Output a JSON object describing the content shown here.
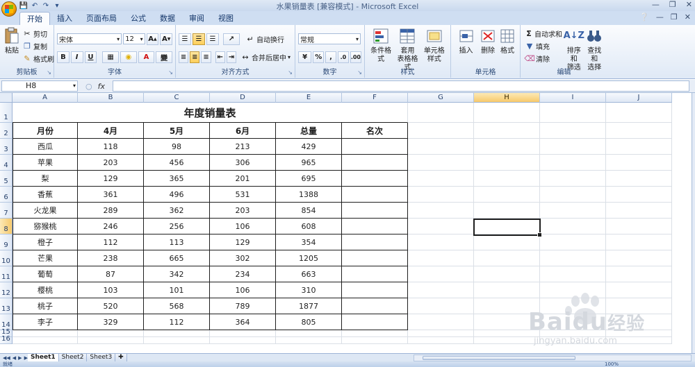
{
  "window": {
    "title": "水果销量表  [兼容模式] - Microsoft Excel"
  },
  "tabs": [
    {
      "label": "开始",
      "active": true
    },
    {
      "label": "插入"
    },
    {
      "label": "页面布局"
    },
    {
      "label": "公式"
    },
    {
      "label": "数据"
    },
    {
      "label": "审阅"
    },
    {
      "label": "视图"
    }
  ],
  "ribbon": {
    "clipboard": {
      "label": "剪贴板",
      "paste": "粘贴",
      "cut": "剪切",
      "copy": "复制",
      "format_painter": "格式刷"
    },
    "font": {
      "label": "字体",
      "font_name": "宋体",
      "font_size": "12",
      "bold": "B",
      "italic": "I",
      "underline": "U",
      "wen": "變"
    },
    "alignment": {
      "label": "对齐方式",
      "wrap": "自动换行",
      "merge": "合并后居中"
    },
    "number": {
      "label": "数字",
      "format": "常规",
      "percent": "%",
      "comma": ","
    },
    "styles": {
      "label": "样式",
      "conditional": "条件格式",
      "table_format": "套用\n表格格式",
      "cell_style": "单元格\n样式"
    },
    "cells": {
      "label": "单元格",
      "insert": "插入",
      "delete": "删除",
      "format": "格式"
    },
    "editing": {
      "label": "编辑",
      "autosum": "自动求和",
      "fill": "填充",
      "clear": "清除",
      "sort": "排序和\n筛选",
      "find": "查找和\n选择"
    }
  },
  "formula_bar": {
    "name_box": "H8",
    "fx": "fx",
    "value": ""
  },
  "columns": [
    "A",
    "B",
    "C",
    "D",
    "E",
    "F",
    "G",
    "H",
    "I",
    "J"
  ],
  "selected_cell": {
    "col": "H",
    "row": "8"
  },
  "sheet": {
    "title": "年度销量表",
    "headers": [
      "月份",
      "4月",
      "5月",
      "6月",
      "总量",
      "名次"
    ],
    "rows": [
      [
        "西瓜",
        "118",
        "98",
        "213",
        "429",
        ""
      ],
      [
        "苹果",
        "203",
        "456",
        "306",
        "965",
        ""
      ],
      [
        "梨",
        "129",
        "365",
        "201",
        "695",
        ""
      ],
      [
        "香蕉",
        "361",
        "496",
        "531",
        "1388",
        ""
      ],
      [
        "火龙果",
        "289",
        "362",
        "203",
        "854",
        ""
      ],
      [
        "猕猴桃",
        "246",
        "256",
        "106",
        "608",
        ""
      ],
      [
        "橙子",
        "112",
        "113",
        "129",
        "354",
        ""
      ],
      [
        "芒果",
        "238",
        "665",
        "302",
        "1205",
        ""
      ],
      [
        "葡萄",
        "87",
        "342",
        "234",
        "663",
        ""
      ],
      [
        "樱桃",
        "103",
        "101",
        "106",
        "310",
        ""
      ],
      [
        "桃子",
        "520",
        "568",
        "789",
        "1877",
        ""
      ],
      [
        "李子",
        "329",
        "112",
        "364",
        "805",
        ""
      ]
    ],
    "row_numbers": [
      "1",
      "2",
      "3",
      "4",
      "5",
      "6",
      "7",
      "8",
      "9",
      "10",
      "11",
      "12",
      "13",
      "14",
      "15",
      "16"
    ]
  },
  "sheet_tabs": [
    {
      "label": "Sheet1",
      "active": true
    },
    {
      "label": "Sheet2"
    },
    {
      "label": "Sheet3"
    }
  ],
  "status": {
    "mode": "就绪",
    "zoom": "100%"
  },
  "watermark": {
    "brand": "Bai",
    "brand2": "du",
    "cn": "经验",
    "url": "jingyan.baidu.com"
  },
  "colors": {
    "accent": "#f7c96b",
    "ribbon": "#dfe9f6",
    "grid_line": "#dadfe6"
  }
}
